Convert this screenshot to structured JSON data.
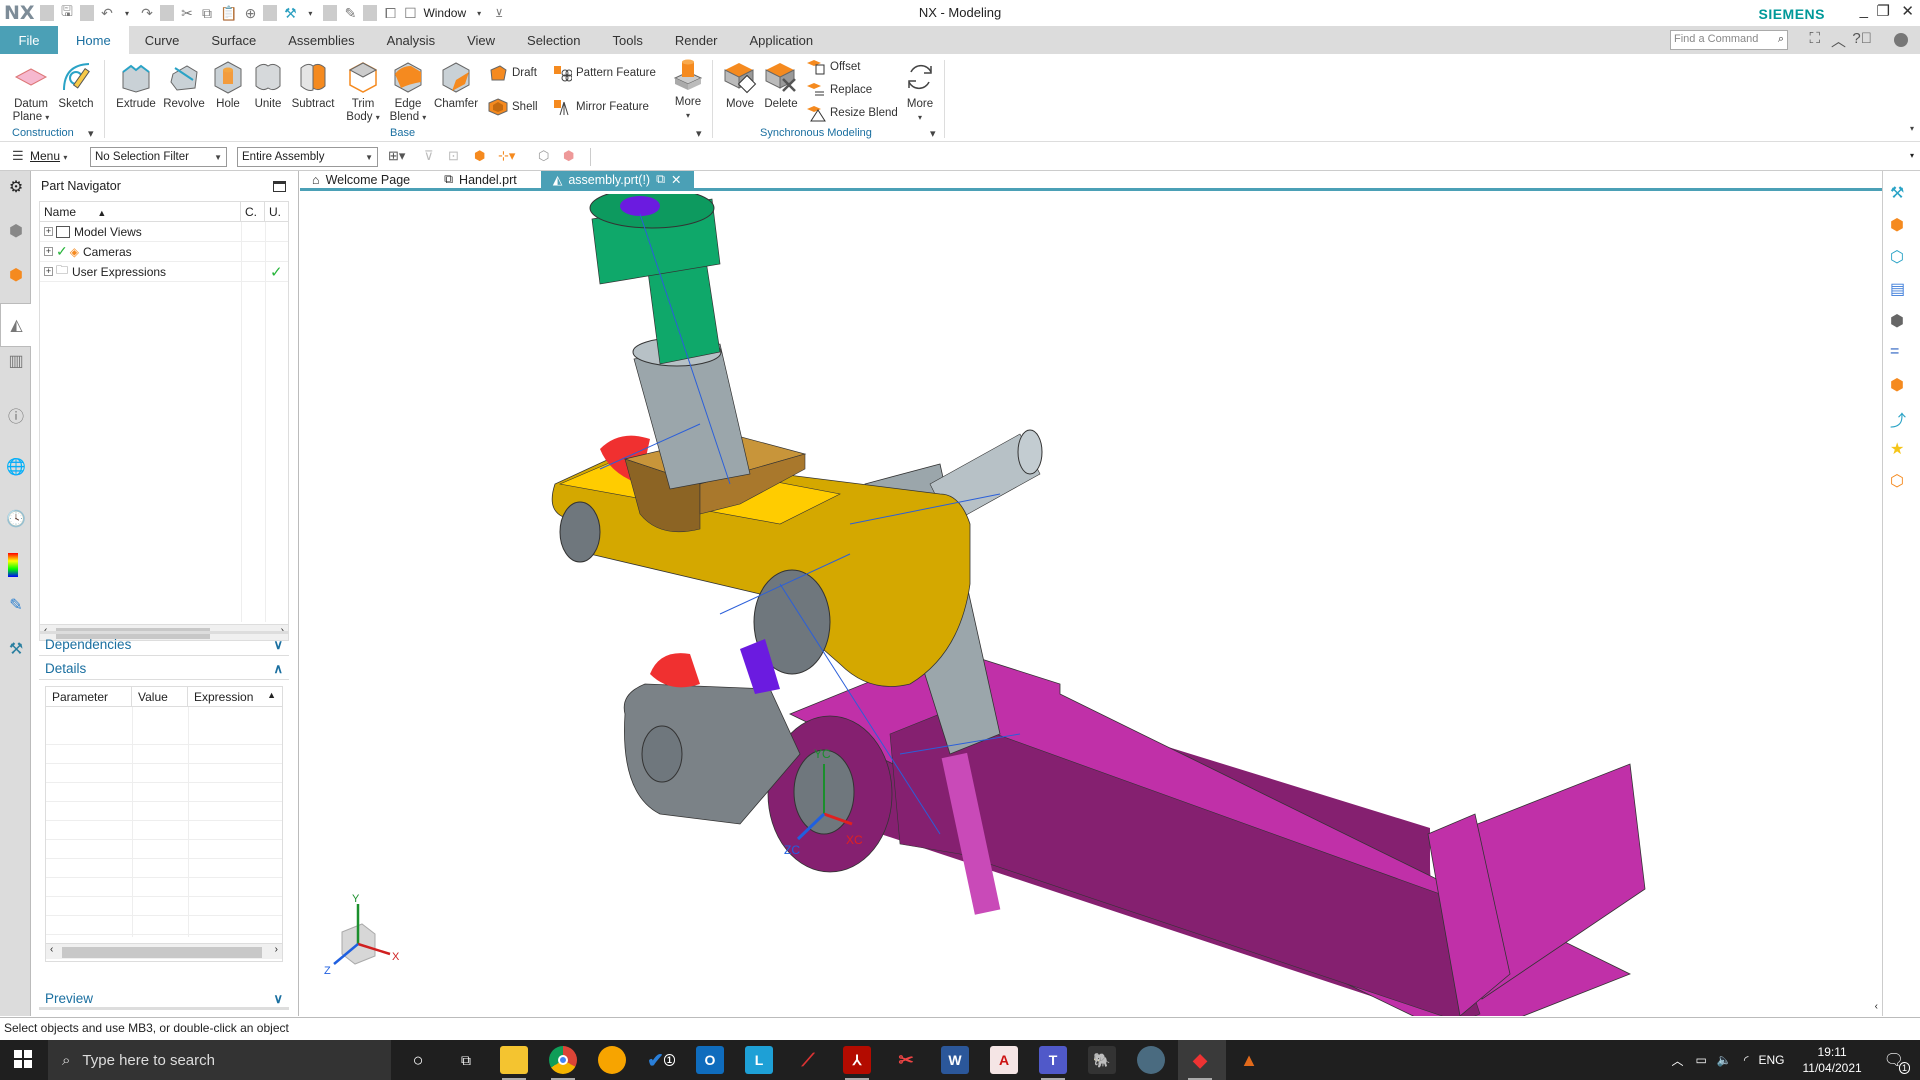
{
  "window": {
    "app_logo": "NX",
    "title": "NX - Modeling",
    "brand": "SIEMENS",
    "quick_access": {
      "window_menu_label": "Window"
    },
    "controls": {
      "minimize": "_",
      "restore": "❐",
      "close": "✕"
    }
  },
  "ribbon_tabs": [
    {
      "label": "File"
    },
    {
      "label": "Home"
    },
    {
      "label": "Curve"
    },
    {
      "label": "Surface"
    },
    {
      "label": "Assemblies"
    },
    {
      "label": "Analysis"
    },
    {
      "label": "View"
    },
    {
      "label": "Selection"
    },
    {
      "label": "Tools"
    },
    {
      "label": "Render"
    },
    {
      "label": "Application"
    }
  ],
  "active_tab": "Home",
  "find_command": {
    "placeholder": "Find a Command"
  },
  "ribbon": {
    "groups": {
      "construction": "Construction",
      "base": "Base",
      "sync": "Synchronous Modeling"
    },
    "buttons": {
      "datum_plane": [
        "Datum",
        "Plane"
      ],
      "sketch": "Sketch",
      "extrude": "Extrude",
      "revolve": "Revolve",
      "hole": "Hole",
      "unite": "Unite",
      "subtract": "Subtract",
      "trim_body": [
        "Trim",
        "Body"
      ],
      "edge_blend": [
        "Edge",
        "Blend"
      ],
      "chamfer": "Chamfer",
      "draft": "Draft",
      "shell": "Shell",
      "pattern_feature": "Pattern Feature",
      "mirror_feature": "Mirror Feature",
      "more_base": "More",
      "move": "Move",
      "delete": "Delete",
      "offset": "Offset",
      "replace": "Replace",
      "resize_blend": "Resize Blend",
      "more_sync": "More"
    }
  },
  "toolbar": {
    "menu_label": "Menu",
    "selection_filter": "No Selection Filter",
    "selection_scope": "Entire Assembly"
  },
  "navigator": {
    "title": "Part Navigator",
    "columns": [
      "Name",
      "C.",
      "U."
    ],
    "rows": [
      {
        "name": "Model Views",
        "checked": false,
        "u_check": false
      },
      {
        "name": "Cameras",
        "checked": true,
        "u_check": false
      },
      {
        "name": "User Expressions",
        "checked": false,
        "u_check": true
      }
    ],
    "dependencies_label": "Dependencies",
    "details_label": "Details",
    "details_columns": [
      "Parameter",
      "Value",
      "Expression"
    ],
    "preview_label": "Preview"
  },
  "doc_tabs": [
    {
      "label": "Welcome Page",
      "icon": "home-icon"
    },
    {
      "label": "Handel.prt",
      "icon": "part-icon"
    },
    {
      "label": "assembly.prt(!)",
      "icon": "assembly-icon",
      "active": true
    }
  ],
  "viewport": {
    "wcs_labels": {
      "x": "XC",
      "y": "YC",
      "z": "ZC"
    },
    "triad_labels": {
      "x": "X",
      "y": "Y",
      "z": "Z"
    },
    "part_colors": {
      "pin_top": "#6b1be0",
      "bushing": "#0fa86a",
      "sleeve": "#9ba6ab",
      "link": "#d4a800",
      "link_top": "#ffcc00",
      "block": "#c8953a",
      "roller": "#f03030",
      "lever_gray": "#7b8287",
      "handle": "#c030a8",
      "handle_dark": "#852070",
      "constraint": "#2b5fd9"
    }
  },
  "status": {
    "message": "Select objects and use MB3, or double-click an object"
  },
  "taskbar": {
    "search_placeholder": "Type here to search",
    "apps": [
      {
        "name": "task-view",
        "label": ""
      },
      {
        "name": "file-explorer",
        "label": ""
      },
      {
        "name": "chrome",
        "label": ""
      },
      {
        "name": "weather",
        "label": ""
      },
      {
        "name": "todo",
        "label": "1"
      },
      {
        "name": "outlook",
        "label": "O"
      },
      {
        "name": "lync",
        "label": "L"
      },
      {
        "name": "app-red",
        "label": ""
      },
      {
        "name": "acrobat",
        "label": ""
      },
      {
        "name": "snipping",
        "label": ""
      },
      {
        "name": "word",
        "label": "W"
      },
      {
        "name": "autocad",
        "label": "A"
      },
      {
        "name": "teams",
        "label": "T"
      },
      {
        "name": "evernote",
        "label": ""
      },
      {
        "name": "globe",
        "label": ""
      },
      {
        "name": "nx",
        "label": ""
      },
      {
        "name": "matlab",
        "label": ""
      }
    ],
    "tray": {
      "language": "ENG",
      "time": "19:11",
      "date": "11/04/2021",
      "notifications": "1"
    }
  }
}
